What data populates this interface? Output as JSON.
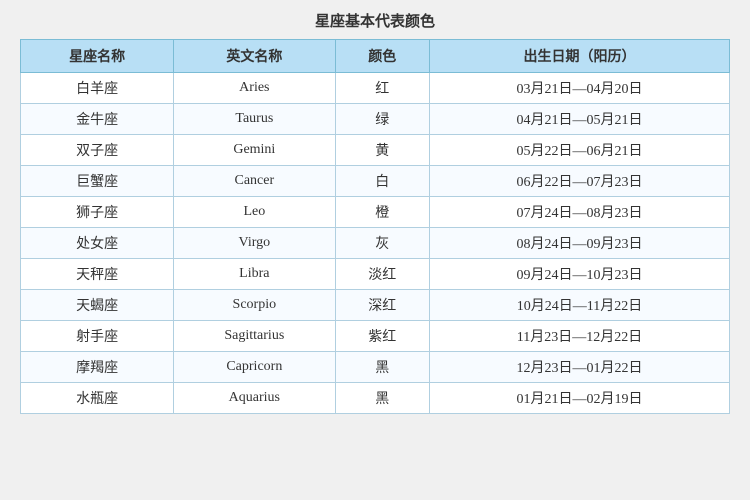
{
  "title": "星座基本代表颜色",
  "table": {
    "headers": [
      "星座名称",
      "英文名称",
      "颜色",
      "出生日期（阳历）"
    ],
    "rows": [
      {
        "zh": "白羊座",
        "en": "Aries",
        "color": "红",
        "dates": "03月21日—04月20日"
      },
      {
        "zh": "金牛座",
        "en": "Taurus",
        "color": "绿",
        "dates": "04月21日—05月21日"
      },
      {
        "zh": "双子座",
        "en": "Gemini",
        "color": "黄",
        "dates": "05月22日—06月21日"
      },
      {
        "zh": "巨蟹座",
        "en": "Cancer",
        "color": "白",
        "dates": "06月22日—07月23日"
      },
      {
        "zh": "狮子座",
        "en": "Leo",
        "color": "橙",
        "dates": "07月24日—08月23日"
      },
      {
        "zh": "处女座",
        "en": "Virgo",
        "color": "灰",
        "dates": "08月24日—09月23日"
      },
      {
        "zh": "天秤座",
        "en": "Libra",
        "color": "淡红",
        "dates": "09月24日—10月23日"
      },
      {
        "zh": "天蝎座",
        "en": "Scorpio",
        "color": "深红",
        "dates": "10月24日—11月22日"
      },
      {
        "zh": "射手座",
        "en": "Sagittarius",
        "color": "紫红",
        "dates": "11月23日—12月22日"
      },
      {
        "zh": "摩羯座",
        "en": "Capricorn",
        "color": "黑",
        "dates": "12月23日—01月22日"
      },
      {
        "zh": "水瓶座",
        "en": "Aquarius",
        "color": "黑",
        "dates": "01月21日—02月19日"
      }
    ]
  }
}
